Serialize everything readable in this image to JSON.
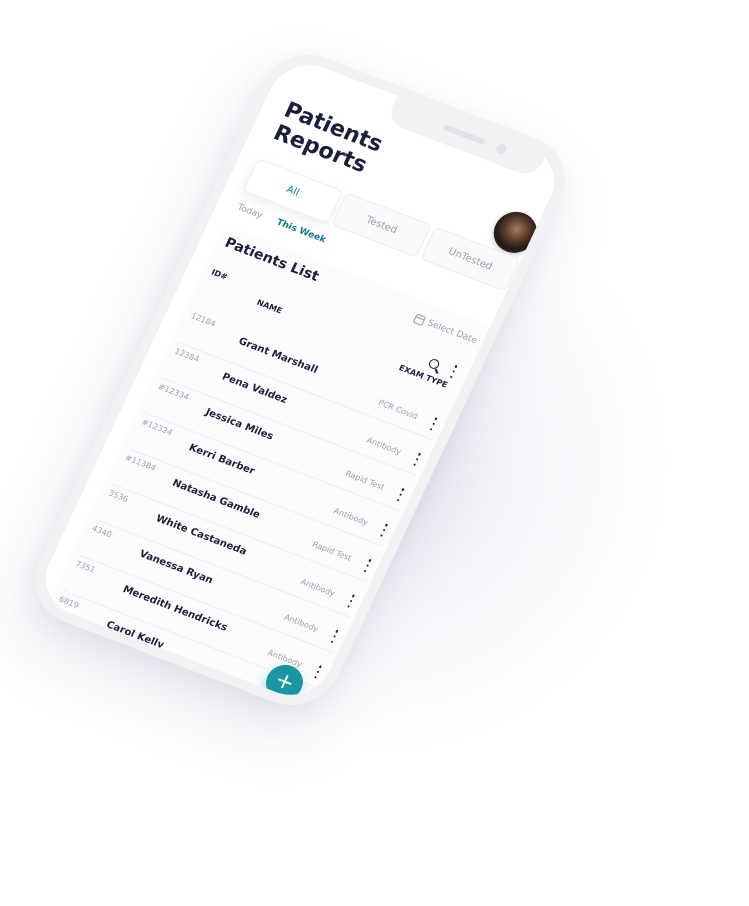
{
  "header": {
    "title_line1": "Patients",
    "title_line2": "Reports"
  },
  "tabs": [
    {
      "label": "All",
      "active": true
    },
    {
      "label": "Tested",
      "active": false
    },
    {
      "label": "UnTested",
      "active": false
    }
  ],
  "subtabs": [
    {
      "label": "Today",
      "active": false
    },
    {
      "label": "This Week",
      "active": true
    }
  ],
  "list": {
    "title": "Patients List",
    "select_date_label": "Select Date",
    "columns": {
      "id": "ID#",
      "name": "NAME",
      "exam_type": "EXAM TYPE"
    },
    "rows": [
      {
        "id": "12184",
        "name": "Grant Marshall",
        "exam": "PCR Covid"
      },
      {
        "id": "12384",
        "name": "Pena Valdez",
        "exam": "Antibody"
      },
      {
        "id": "#12334",
        "name": "Jessica Miles",
        "exam": "Rapid Test"
      },
      {
        "id": "#12324",
        "name": "Kerri Barber",
        "exam": "Antibody"
      },
      {
        "id": "#11384",
        "name": "Natasha Gamble",
        "exam": "Rapid Test"
      },
      {
        "id": "3536",
        "name": "White Castaneda",
        "exam": "Antibody"
      },
      {
        "id": "4340",
        "name": "Vanessa Ryan",
        "exam": "Antibody"
      },
      {
        "id": "7351",
        "name": "Meredith Hendricks",
        "exam": "Antibody"
      },
      {
        "id": "6819",
        "name": "Carol Kelly",
        "exam": "Antibody"
      }
    ]
  },
  "fab": {
    "icon": "plus-icon",
    "label": "+"
  },
  "colors": {
    "accent": "#157b8a",
    "fab": "#1a95a1",
    "text": "#1c1e3a",
    "muted": "#9a9cab"
  }
}
